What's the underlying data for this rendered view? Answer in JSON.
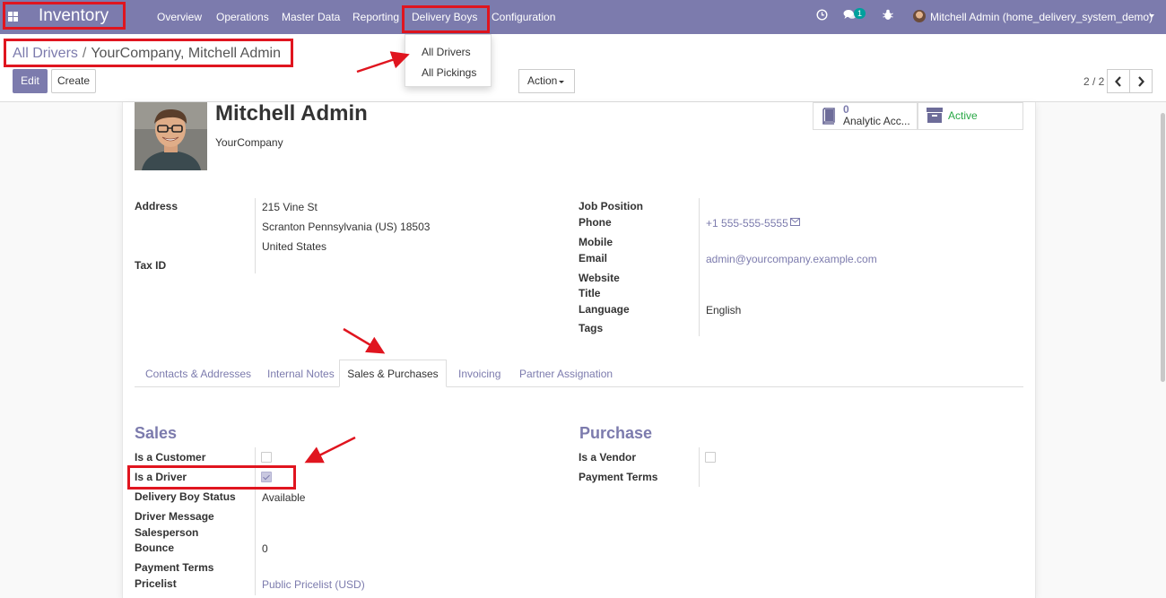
{
  "app": {
    "name": "Inventory"
  },
  "menu": [
    "Overview",
    "Operations",
    "Master Data",
    "Reporting",
    "Delivery Boys",
    "Configuration"
  ],
  "systray": {
    "messages_count": "1",
    "user_name": "Mitchell Admin (home_delivery_system_demo)"
  },
  "dropdown": [
    "All Drivers",
    "All Pickings"
  ],
  "breadcrumb": {
    "parent": "All Drivers",
    "current": "YourCompany, Mitchell Admin"
  },
  "buttons": {
    "edit": "Edit",
    "create": "Create",
    "action": "Action"
  },
  "pager": {
    "value": "2 / 2"
  },
  "partner": {
    "name": "Mitchell Admin",
    "company": "YourCompany"
  },
  "smart_buttons": {
    "analytic_count": "0",
    "analytic_label": "Analytic Acc...",
    "active_label": "Active"
  },
  "fields": {
    "address_label": "Address",
    "street": "215 Vine St",
    "city_line": "Scranton  Pennsylvania (US)  18503",
    "country": "United States",
    "tax_id_label": "Tax ID",
    "job_position_label": "Job Position",
    "phone_label": "Phone",
    "phone": "+1 555-555-5555",
    "mobile_label": "Mobile",
    "email_label": "Email",
    "email": "admin@yourcompany.example.com",
    "website_label": "Website",
    "title_label": "Title",
    "language_label": "Language",
    "language": "English",
    "tags_label": "Tags"
  },
  "tabs": [
    "Contacts & Addresses",
    "Internal Notes",
    "Sales & Purchases",
    "Invoicing",
    "Partner Assignation"
  ],
  "sales": {
    "title": "Sales",
    "is_customer_label": "Is a Customer",
    "is_customer": false,
    "is_driver_label": "Is a Driver",
    "is_driver": true,
    "delivery_status_label": "Delivery Boy Status",
    "delivery_status": "Available",
    "driver_message_label": "Driver Message",
    "salesperson_label": "Salesperson",
    "bounce_label": "Bounce",
    "bounce": "0",
    "payment_terms_label": "Payment Terms",
    "pricelist_label": "Pricelist",
    "pricelist": "Public Pricelist (USD)"
  },
  "purchase": {
    "title": "Purchase",
    "is_vendor_label": "Is a Vendor",
    "is_vendor": false,
    "payment_terms_label": "Payment Terms"
  },
  "colors": {
    "brand": "#7c7bad",
    "highlight": "#e0151f",
    "active": "#28a745"
  }
}
